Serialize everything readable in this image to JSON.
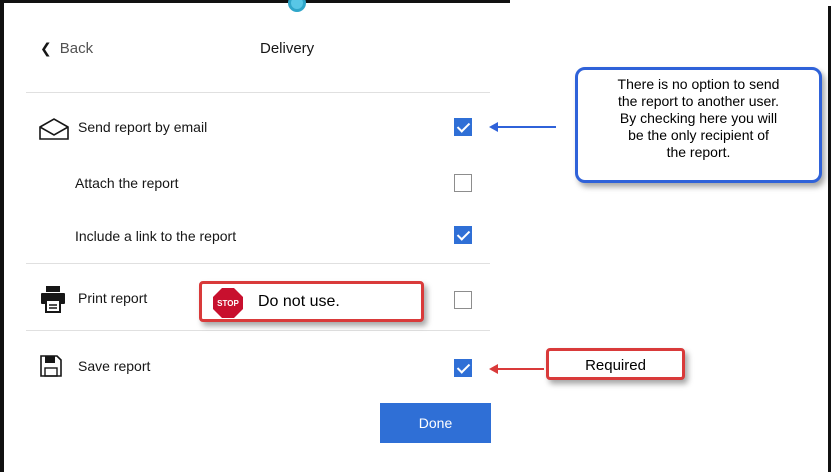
{
  "header": {
    "back_label": "Back",
    "title": "Delivery"
  },
  "rows": {
    "email": {
      "label": "Send report by email",
      "checked": true,
      "icon": "envelope-icon"
    },
    "attach": {
      "label": "Attach the report",
      "checked": false
    },
    "link": {
      "label": "Include a link to the report",
      "checked": true
    },
    "print": {
      "label": "Print report",
      "checked": false,
      "icon": "printer-icon"
    },
    "save": {
      "label": "Save report",
      "checked": true,
      "icon": "floppy-disk-icon"
    }
  },
  "done_label": "Done",
  "annotations": {
    "email_note_lines": [
      "There is no option to send",
      "the report to another user.",
      "By checking here you will",
      "be the only recipient of",
      "the report."
    ],
    "print_note": "Do not use.",
    "stop_sign_text": "STOP",
    "save_note": "Required"
  },
  "colors": {
    "accent": "#2f6fd6",
    "callout_blue": "#2f62d9",
    "callout_red": "#d93a3a",
    "stop_sign": "#c8102e"
  }
}
